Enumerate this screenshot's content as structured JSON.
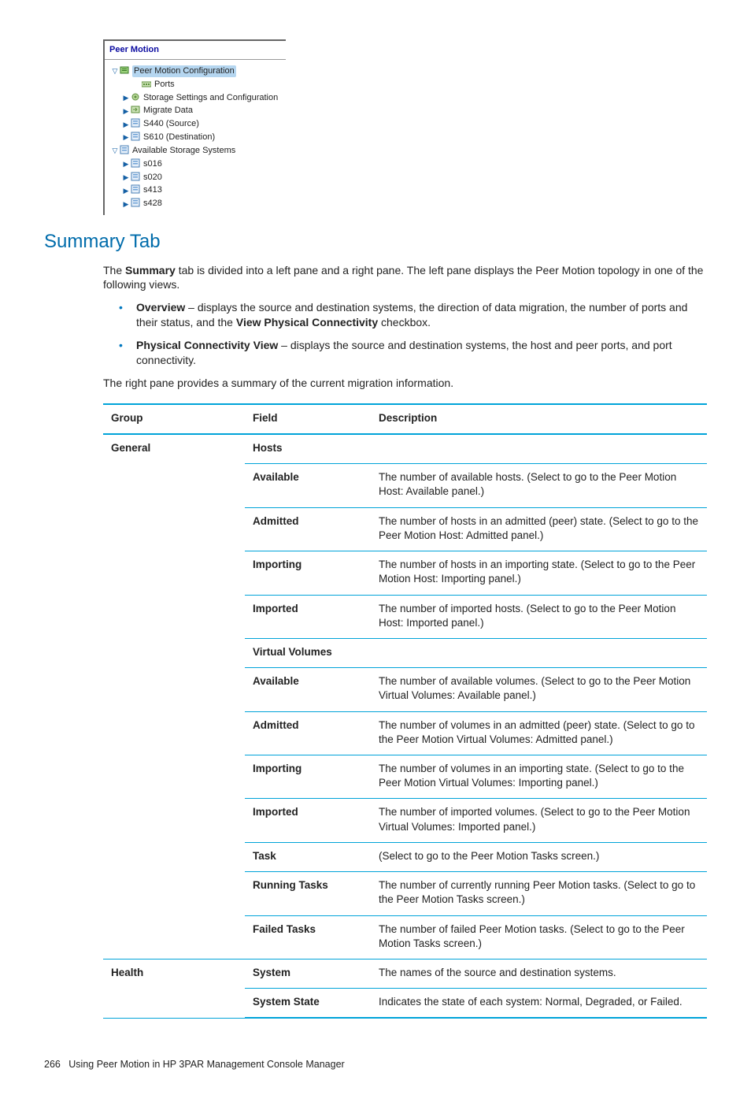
{
  "tree": {
    "title": "Peer Motion",
    "root": "Peer Motion Configuration",
    "items": [
      {
        "label": "Ports",
        "level": "ind2",
        "tri": "",
        "icon": "ports"
      },
      {
        "label": "Storage Settings and Configuration",
        "level": "ind1",
        "tri": "▶",
        "icon": "gear"
      },
      {
        "label": "Migrate Data",
        "level": "ind1",
        "tri": "▶",
        "icon": "mig"
      },
      {
        "label": "S440 (Source)",
        "level": "ind1",
        "tri": "▶",
        "icon": "sys"
      },
      {
        "label": "S610 (Destination)",
        "level": "ind1",
        "tri": "▶",
        "icon": "sys"
      }
    ],
    "avail_label": "Available Storage Systems",
    "avail": [
      "s016",
      "s020",
      "s413",
      "s428"
    ]
  },
  "heading": "Summary Tab",
  "intro": {
    "p1a": "The ",
    "p1b": "Summary",
    "p1c": " tab is divided into a left pane and a right pane. The left pane displays the Peer Motion topology in one of the following views.",
    "b1a": "Overview",
    "b1b": " – displays the source and destination systems, the direction of data migration, the number of ports and their status, and the ",
    "b1c": "View Physical Connectivity",
    "b1d": " checkbox.",
    "b2a": "Physical Connectivity View",
    "b2b": " – displays the source and destination systems, the host and peer ports, and port connectivity.",
    "p2": "The right pane provides a summary of the current migration information."
  },
  "table": {
    "headers": [
      "Group",
      "Field",
      "Description"
    ],
    "group_general": "General",
    "group_health": "Health",
    "sub_hosts": "Hosts",
    "sub_vv": "Virtual Volumes",
    "rows": [
      {
        "field": "Available",
        "desc": "The number of available hosts. (Select to go to the Peer Motion Host: Available panel.)"
      },
      {
        "field": "Admitted",
        "desc": "The number of hosts in an admitted (peer) state. (Select to go to the Peer Motion Host: Admitted panel.)"
      },
      {
        "field": "Importing",
        "desc": "The number of hosts in an importing state. (Select to go to the Peer Motion Host: Importing panel.)"
      },
      {
        "field": "Imported",
        "desc": "The number of imported hosts. (Select to go to the Peer Motion Host: Imported panel.)"
      },
      {
        "field": "Available",
        "desc": "The number of available volumes. (Select to go to the Peer Motion Virtual Volumes: Available panel.)"
      },
      {
        "field": "Admitted",
        "desc": "The number of volumes in an admitted (peer) state. (Select to go to the Peer Motion Virtual Volumes: Admitted panel.)"
      },
      {
        "field": "Importing",
        "desc": "The number of volumes in an importing state. (Select to go to the Peer Motion Virtual Volumes: Importing panel.)"
      },
      {
        "field": "Imported",
        "desc": "The number of imported volumes. (Select to go to the Peer Motion Virtual Volumes: Imported panel.)"
      },
      {
        "field": "Task",
        "desc": "(Select to go to the Peer Motion Tasks screen.)"
      },
      {
        "field": "Running Tasks",
        "desc": "The number of currently running Peer Motion tasks. (Select to go to the Peer Motion Tasks screen.)"
      },
      {
        "field": "Failed Tasks",
        "desc": "The number of failed Peer Motion tasks. (Select to go to the Peer Motion Tasks screen.)"
      },
      {
        "field": "System",
        "desc": "The names of the source and destination systems."
      },
      {
        "field": "System State",
        "desc": "Indicates the state of each system: Normal, Degraded, or Failed."
      }
    ]
  },
  "footer": {
    "page": "266",
    "title": "Using Peer Motion in HP 3PAR Management Console Manager"
  }
}
